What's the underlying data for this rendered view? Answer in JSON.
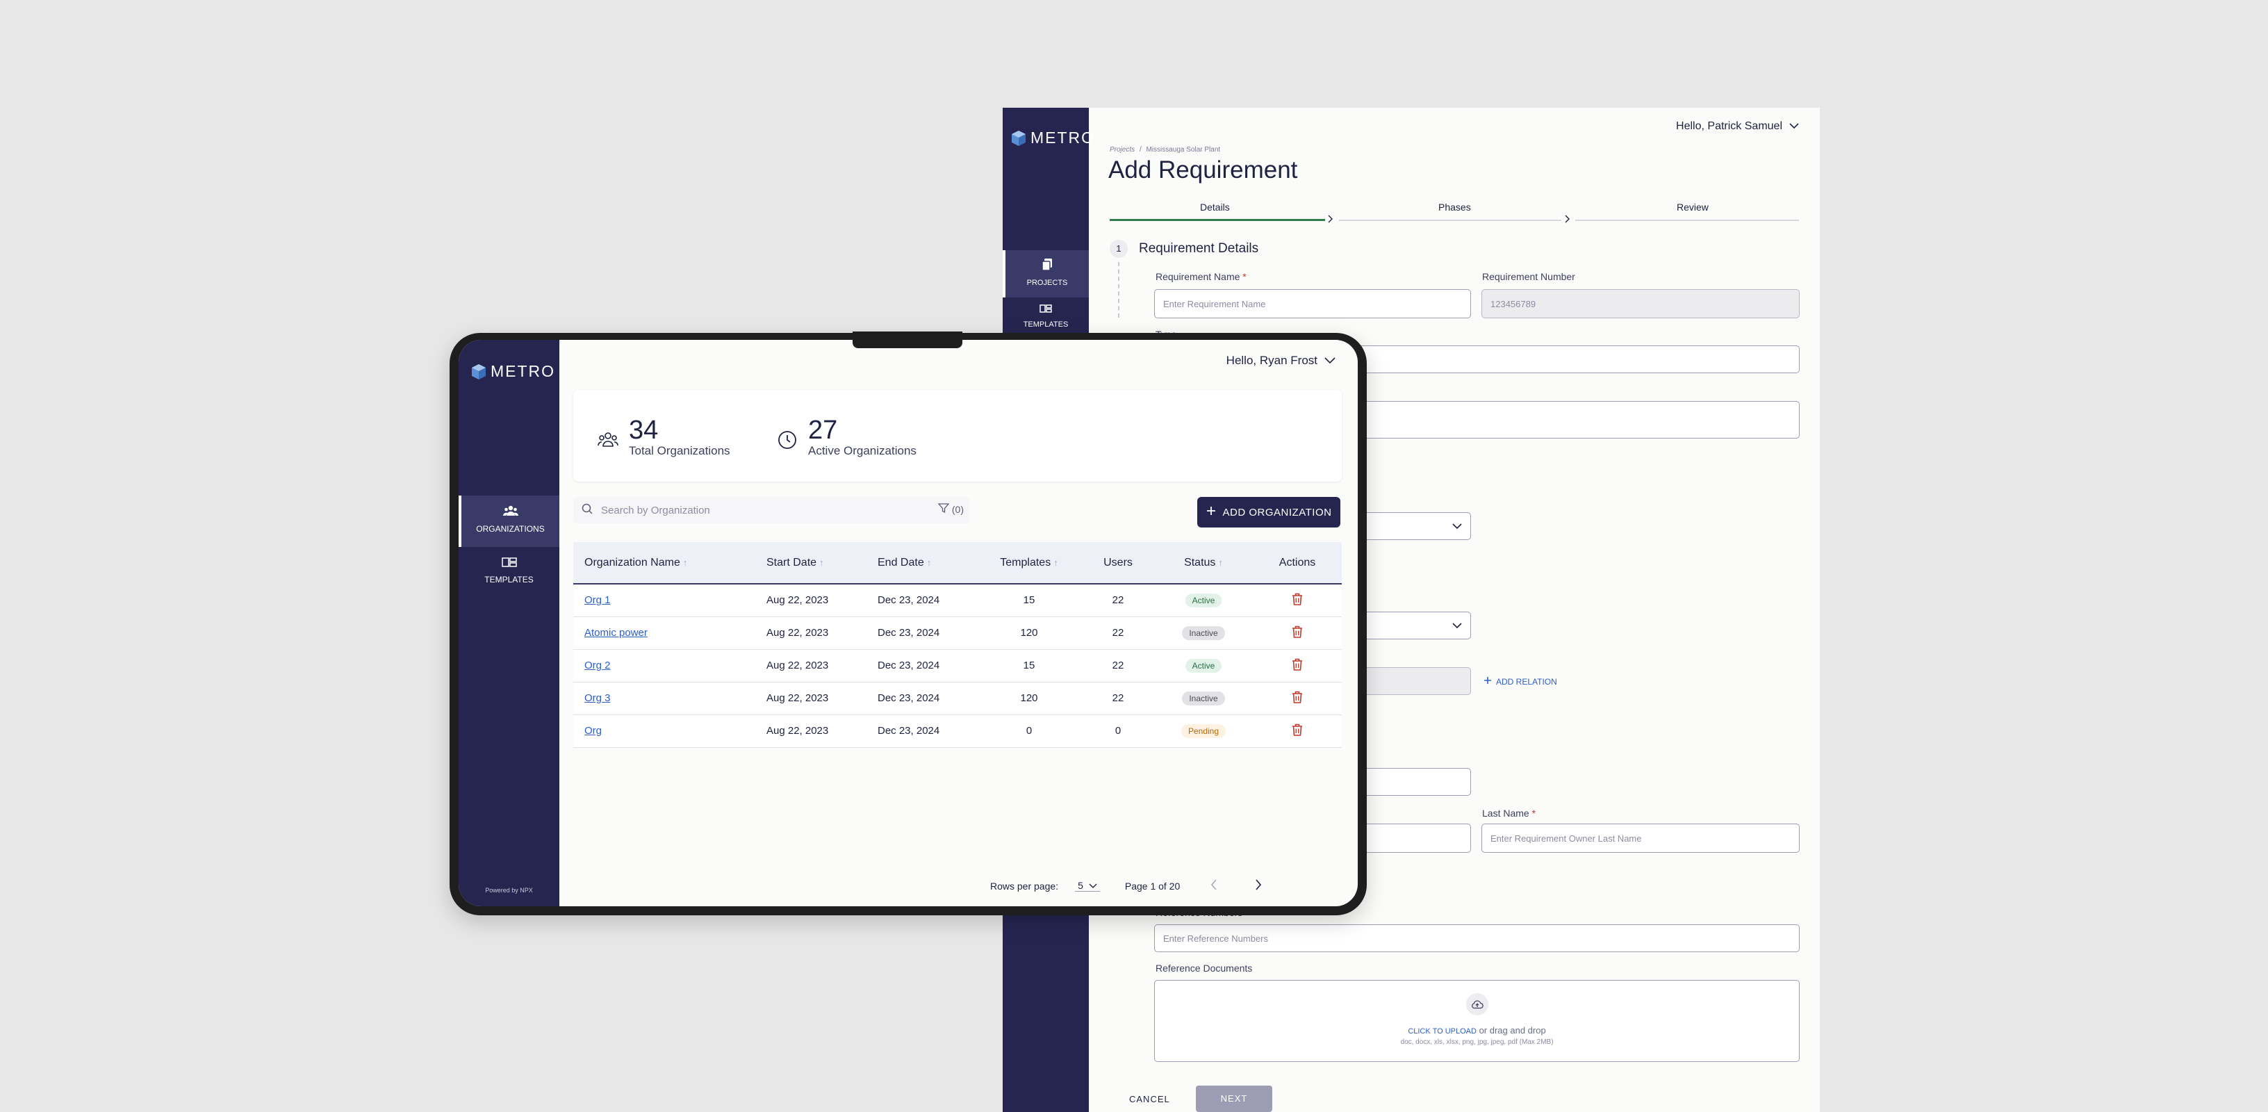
{
  "back": {
    "brand": "METRO",
    "nav": [
      {
        "label": "PROJECTS"
      },
      {
        "label": "TEMPLATES"
      }
    ],
    "greeting": "Hello, Patrick Samuel",
    "breadcrumb": {
      "root": "Projects",
      "sep": "/",
      "current": "Mississauga Solar Plant"
    },
    "title": "Add Requirement",
    "steps": [
      "Details",
      "Phases",
      "Review"
    ],
    "active_step": "Details",
    "section": {
      "number": "1",
      "title": "Requirement Details"
    },
    "fields": {
      "req_name_label": "Requirement Name",
      "req_name_placeholder": "Enter Requirement Name",
      "req_number_label": "Requirement Number",
      "req_number_value": "123456789",
      "type_label_partial": "Type",
      "last_name_label": "Last Name",
      "last_name_placeholder": "Enter Requirement Owner Last Name",
      "ref_numbers_label": "Reference Numbers",
      "ref_numbers_placeholder": "Enter Reference Numbers",
      "ref_docs_label": "Reference Documents",
      "required_mark": "*"
    },
    "add_relation": "ADD RELATION",
    "upload": {
      "link": "CLICK TO UPLOAD",
      "text": "or drag and drop",
      "hint": "doc, docx, xls, xlsx, png, jpg, jpeg, pdf (Max 2MB)"
    },
    "cancel": "CANCEL",
    "next": "NEXT"
  },
  "front": {
    "brand": "METRO",
    "nav": [
      {
        "label": "ORGANIZATIONS"
      },
      {
        "label": "TEMPLATES"
      }
    ],
    "powered_by": "Powered by NPX",
    "greeting": "Hello, Ryan Frost",
    "stats": [
      {
        "value": "34",
        "label": "Total Organizations"
      },
      {
        "value": "27",
        "label": "Active Organizations"
      }
    ],
    "search_placeholder": "Search by Organization",
    "filter_count": "(0)",
    "add_button": "ADD ORGANIZATION",
    "table": {
      "columns": [
        "Organization Name",
        "Start Date",
        "End Date",
        "Templates",
        "Users",
        "Status",
        "Actions"
      ],
      "rows": [
        {
          "name": "Org 1",
          "start": "Aug 22, 2023",
          "end": "Dec 23, 2024",
          "templates": "15",
          "users": "22",
          "status": "Active"
        },
        {
          "name": "Atomic power",
          "start": "Aug 22, 2023",
          "end": "Dec 23, 2024",
          "templates": "120",
          "users": "22",
          "status": "Inactive"
        },
        {
          "name": "Org 2",
          "start": "Aug 22, 2023",
          "end": "Dec 23, 2024",
          "templates": "15",
          "users": "22",
          "status": "Active"
        },
        {
          "name": "Org 3",
          "start": "Aug 22, 2023",
          "end": "Dec 23, 2024",
          "templates": "120",
          "users": "22",
          "status": "Inactive"
        },
        {
          "name": "Org",
          "start": "Aug 22, 2023",
          "end": "Dec 23, 2024",
          "templates": "0",
          "users": "0",
          "status": "Pending"
        }
      ]
    },
    "pagination": {
      "rows_label": "Rows per page:",
      "rows_value": "5",
      "page_text": "Page 1 of 20"
    }
  },
  "colors": {
    "sidebar": "#252550",
    "accent_link": "#2d5fc5",
    "step_active": "#2e7d4f",
    "delete": "#c0392b"
  }
}
